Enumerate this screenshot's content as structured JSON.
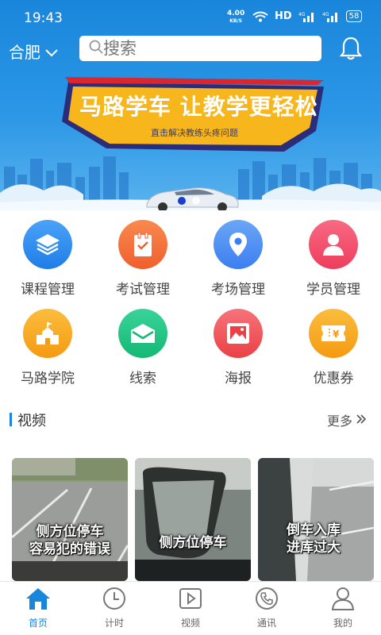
{
  "status_bar": {
    "time": "19:43",
    "net_speed": "4.00",
    "net_unit": "KB/S",
    "hd": "HD",
    "net_type_1": "4G",
    "net_type_2": "4G",
    "battery": "58"
  },
  "header": {
    "city": "合肥",
    "search_placeholder": "搜索"
  },
  "banner": {
    "title": "马路学车 让教学更轻松",
    "subtitle": "直击解决教练头疼问题"
  },
  "grid": [
    {
      "label": "课程管理",
      "icon": "layers-icon",
      "color": "#2f8cf0"
    },
    {
      "label": "考试管理",
      "icon": "clipboard-icon",
      "color": "#f4743a"
    },
    {
      "label": "考场管理",
      "icon": "location-pin-icon",
      "color": "#4f8df3"
    },
    {
      "label": "学员管理",
      "icon": "user-icon",
      "color": "#f2526e"
    },
    {
      "label": "马路学院",
      "icon": "school-icon",
      "color": "#f7a524"
    },
    {
      "label": "线索",
      "icon": "envelope-icon",
      "color": "#22c485"
    },
    {
      "label": "海报",
      "icon": "image-icon",
      "color": "#f0585a"
    },
    {
      "label": "优惠券",
      "icon": "coupon-icon",
      "color": "#f7a524"
    }
  ],
  "videos_section": {
    "title": "视频",
    "more": "更多"
  },
  "videos": [
    {
      "caption_line1": "侧方位停车",
      "caption_line2": "容易犯的错误"
    },
    {
      "caption_line1": "侧方位停车",
      "caption_line2": ""
    },
    {
      "caption_line1": "倒车入库",
      "caption_line2": "进库过大"
    }
  ],
  "bottom_nav": [
    {
      "label": "首页",
      "icon": "home-icon",
      "active": true
    },
    {
      "label": "计时",
      "icon": "clock-icon",
      "active": false
    },
    {
      "label": "视频",
      "icon": "play-icon",
      "active": false
    },
    {
      "label": "通讯",
      "icon": "phone-icon",
      "active": false
    },
    {
      "label": "我的",
      "icon": "person-icon",
      "active": false
    }
  ],
  "colors": {
    "brand_blue": "#1a86db",
    "active_nav": "#1a86db"
  }
}
